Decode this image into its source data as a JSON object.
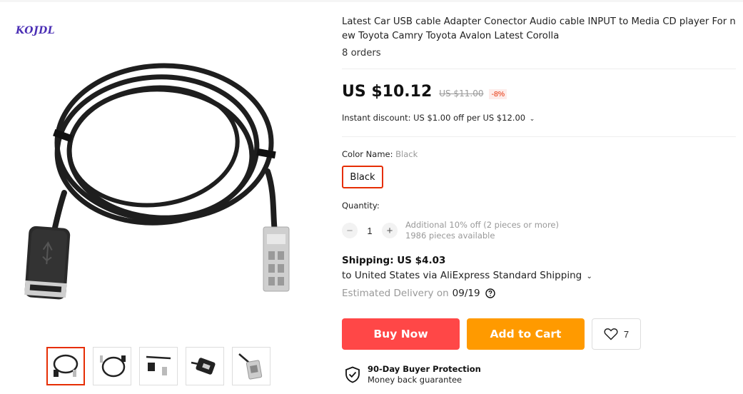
{
  "gallery": {
    "brand": "KOJDL",
    "thumbnails": [
      "cable-coiled",
      "cable-loop",
      "usb-connector",
      "usb-port",
      "plug-end"
    ]
  },
  "product": {
    "title": "Latest Car USB cable Adapter Conector Audio cable INPUT to Media CD player For new Toyota Camry Toyota Avalon Latest Corolla",
    "orders": "8 orders",
    "price": "US $10.12",
    "original_price": "US $11.00",
    "discount": "-8%",
    "instant_discount": "Instant discount: US $1.00 off per US $12.00"
  },
  "options": {
    "color_label": "Color Name:",
    "color_value": "Black",
    "color_button": "Black"
  },
  "quantity": {
    "label": "Quantity:",
    "value": "1",
    "minus": "−",
    "plus": "+",
    "note_1": "Additional 10% off (2 pieces or more)",
    "note_2": "1986 pieces available"
  },
  "shipping": {
    "title": "Shipping: US $4.03",
    "via": "to United States via AliExpress Standard Shipping",
    "delivery_label": "Estimated Delivery on",
    "delivery_date": "09/19"
  },
  "actions": {
    "buy_now": "Buy Now",
    "add_to_cart": "Add to Cart",
    "wishlist_count": "7"
  },
  "protection": {
    "title": "90-Day Buyer Protection",
    "subtitle": "Money back guarantee"
  },
  "colors": {
    "accent": "#e62e04",
    "buy": "#ff4747",
    "cart": "#ff9a00"
  }
}
